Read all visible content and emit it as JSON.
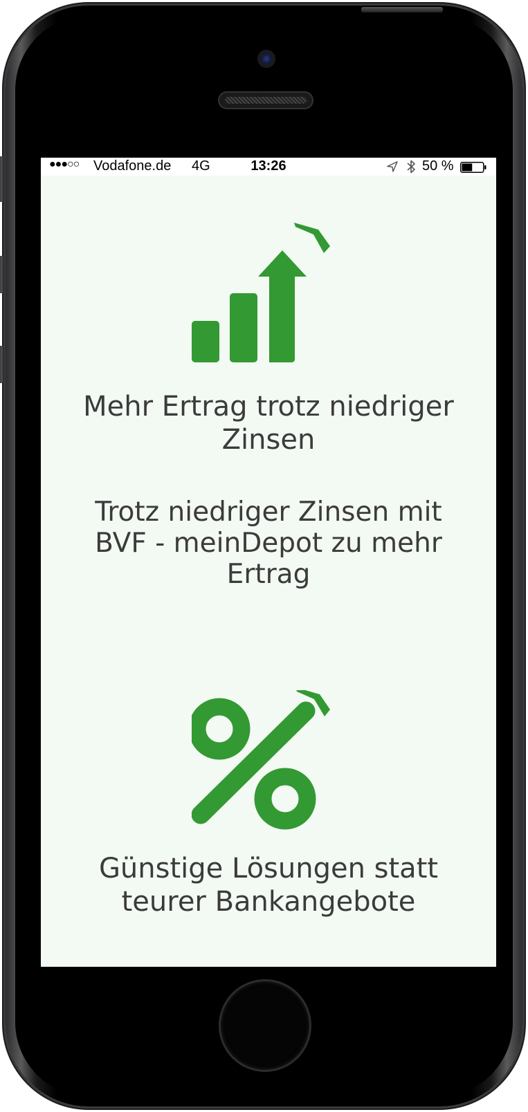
{
  "status_bar": {
    "signal": "●●●○○",
    "carrier": "Vodafone.de",
    "network": "4G",
    "time": "13:26",
    "battery_percent": "50 %",
    "battery_level": 0.5
  },
  "features": [
    {
      "icon": "growth-chart-icon",
      "title": "Mehr Ertrag trotz niedriger Zinsen",
      "description": "Trotz niedriger Zinsen mit BVF - meinDepot zu mehr Ertrag"
    },
    {
      "icon": "percent-icon",
      "title": "Günstige Lösungen statt teurer Bankangebote"
    }
  ],
  "colors": {
    "accent": "#339933",
    "background": "#f3f9f3",
    "text": "#3b3b3b"
  }
}
